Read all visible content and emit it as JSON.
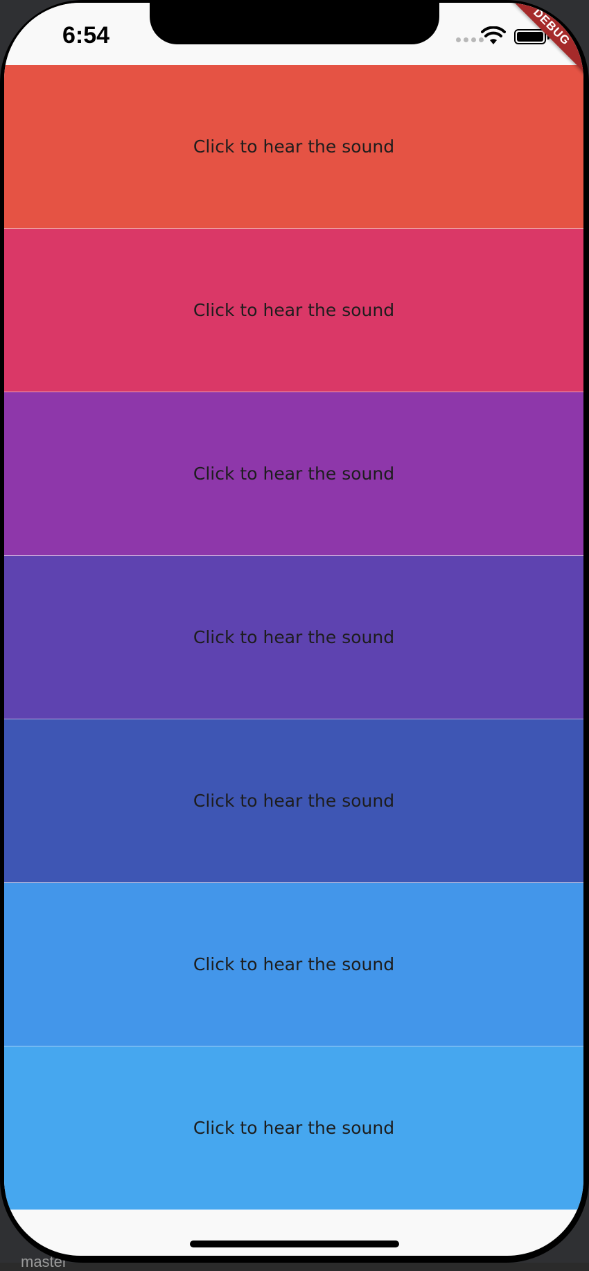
{
  "status_bar": {
    "time": "6:54",
    "wifi_icon": "wifi-icon",
    "battery_icon": "battery-icon"
  },
  "debug_banner": {
    "label": "DEBUG"
  },
  "ide": {
    "branch_text": "master"
  },
  "buttons": [
    {
      "label": "Click to hear the sound",
      "color": "#e55344"
    },
    {
      "label": "Click to hear the sound",
      "color": "#da3867"
    },
    {
      "label": "Click to hear the sound",
      "color": "#8e37aa"
    },
    {
      "label": "Click to hear the sound",
      "color": "#5e43b0"
    },
    {
      "label": "Click to hear the sound",
      "color": "#3e56b4"
    },
    {
      "label": "Click to hear the sound",
      "color": "#4396ea"
    },
    {
      "label": "Click to hear the sound",
      "color": "#46a7ef"
    }
  ]
}
